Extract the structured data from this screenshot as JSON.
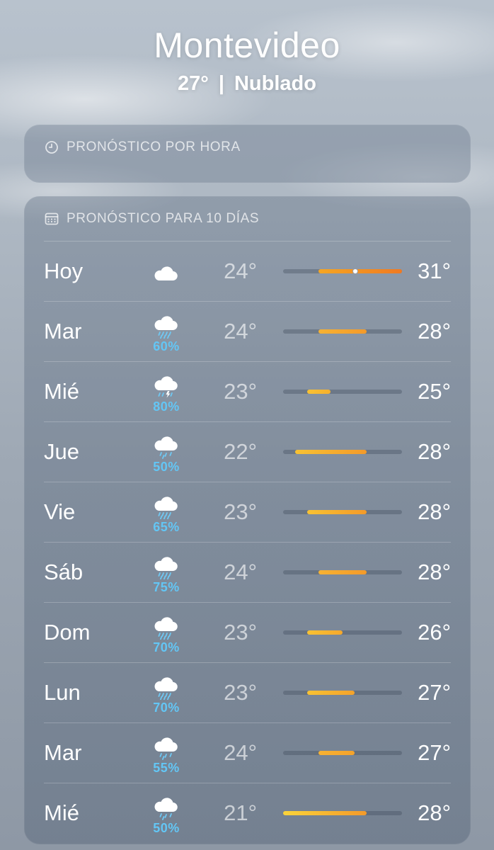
{
  "location": {
    "city": "Montevideo",
    "current_temp": "27°",
    "separator": "|",
    "condition": "Nublado"
  },
  "hourly": {
    "title": "PRONÓSTICO POR HORA",
    "icon": "clock-icon"
  },
  "daily": {
    "title": "PRONÓSTICO PARA 10 DÍAS",
    "icon": "calendar-icon",
    "range_min": 21,
    "range_max": 31,
    "days": [
      {
        "day": "Hoy",
        "icon": "cloud-icon",
        "precip": "",
        "low": "24°",
        "high": "31°",
        "low_value": 24,
        "high_value": 31,
        "current_value": 27,
        "colors": [
          "#f5a623",
          "#f07a22"
        ]
      },
      {
        "day": "Mar",
        "icon": "cloud-rain-icon",
        "precip": "60%",
        "low": "24°",
        "high": "28°",
        "low_value": 24,
        "high_value": 28,
        "colors": [
          "#f7b232",
          "#f39a2a"
        ]
      },
      {
        "day": "Mié",
        "icon": "cloud-bolt-rain-icon",
        "precip": "80%",
        "low": "23°",
        "high": "25°",
        "low_value": 23,
        "high_value": 25,
        "colors": [
          "#f8c233",
          "#f6b02e"
        ]
      },
      {
        "day": "Jue",
        "icon": "cloud-drizzle-icon",
        "precip": "50%",
        "low": "22°",
        "high": "28°",
        "low_value": 22,
        "high_value": 28,
        "colors": [
          "#f8c233",
          "#f39a2a"
        ]
      },
      {
        "day": "Vie",
        "icon": "cloud-rain-icon",
        "precip": "65%",
        "low": "23°",
        "high": "28°",
        "low_value": 23,
        "high_value": 28,
        "colors": [
          "#f8c233",
          "#f39a2a"
        ]
      },
      {
        "day": "Sáb",
        "icon": "cloud-rain-icon",
        "precip": "75%",
        "low": "24°",
        "high": "28°",
        "low_value": 24,
        "high_value": 28,
        "colors": [
          "#f7b232",
          "#f39a2a"
        ]
      },
      {
        "day": "Dom",
        "icon": "cloud-rain-icon",
        "precip": "70%",
        "low": "23°",
        "high": "26°",
        "low_value": 23,
        "high_value": 26,
        "colors": [
          "#f8c233",
          "#f5a82c"
        ]
      },
      {
        "day": "Lun",
        "icon": "cloud-rain-icon",
        "precip": "70%",
        "low": "23°",
        "high": "27°",
        "low_value": 23,
        "high_value": 27,
        "colors": [
          "#f8c233",
          "#f4a22b"
        ]
      },
      {
        "day": "Mar",
        "icon": "cloud-drizzle-icon",
        "precip": "55%",
        "low": "24°",
        "high": "27°",
        "low_value": 24,
        "high_value": 27,
        "colors": [
          "#f7b232",
          "#f4a22b"
        ]
      },
      {
        "day": "Mié",
        "icon": "cloud-drizzle-icon",
        "precip": "50%",
        "low": "21°",
        "high": "28°",
        "low_value": 21,
        "high_value": 28,
        "colors": [
          "#fbd43a",
          "#f39a2a"
        ]
      }
    ]
  }
}
